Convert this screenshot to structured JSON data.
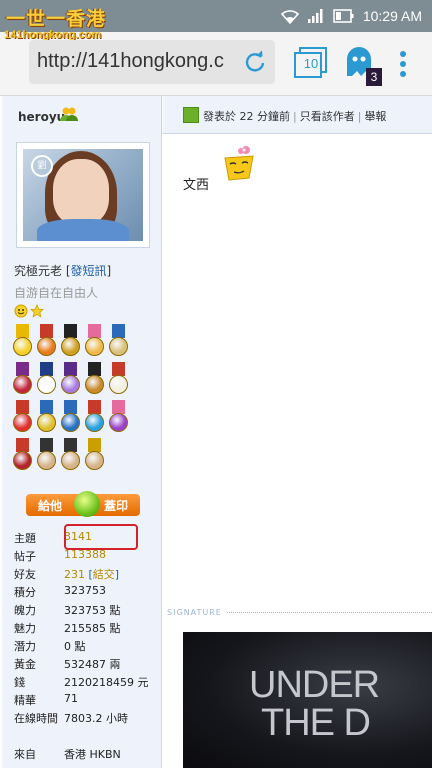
{
  "status_bar": {
    "logo": "一世一香港",
    "time": "10:29 AM"
  },
  "browser": {
    "site_logo": "141hongkong.com",
    "url": "http://141hongkong.c",
    "tab_count": "10",
    "ghost_badge": "3"
  },
  "user": {
    "name": "heroyu",
    "avatar_stamp": "劉",
    "rank_text": "究極元老 ",
    "rank_link_open": "[",
    "rank_link": "發短訊",
    "rank_link_close": "]",
    "motto": "自游自在自由人"
  },
  "medals": [
    {
      "ribbon": "#e8b900",
      "disc": "#f7d12a"
    },
    {
      "ribbon": "#c63a2a",
      "disc": "#e87b1a"
    },
    {
      "ribbon": "#222222",
      "disc": "#d0a020"
    },
    {
      "ribbon": "#e46b9a",
      "disc": "#f0b94a"
    },
    {
      "ribbon": "#2b6ab8",
      "disc": "#d9c07a"
    },
    {
      "ribbon": "#7a2b8a",
      "disc": "#c2263b"
    },
    {
      "ribbon": "#1f3e86",
      "disc": "#ffffff"
    },
    {
      "ribbon": "#5b2b8a",
      "disc": "#a77adf"
    },
    {
      "ribbon": "#222222",
      "disc": "#c98a2a"
    },
    {
      "ribbon": "#c63a2a",
      "disc": "#f2efe0"
    },
    {
      "ribbon": "#c63a2a",
      "disc": "#e03030"
    },
    {
      "ribbon": "#2b6ab8",
      "disc": "#e0c030"
    },
    {
      "ribbon": "#2b6ab8",
      "disc": "#2a72c6"
    },
    {
      "ribbon": "#c63a2a",
      "disc": "#2aa0e0"
    },
    {
      "ribbon": "#e46b9a",
      "disc": "#9a42c9"
    },
    {
      "ribbon": "#c63a2a",
      "disc": "#b3242a"
    },
    {
      "ribbon": "#333333",
      "disc": "#d6b48a"
    },
    {
      "ribbon": "#333333",
      "disc": "#d6b48a"
    },
    {
      "ribbon": "#c9a000",
      "disc": "#d6b48a"
    }
  ],
  "give_button": {
    "left": "給他",
    "right": "蓋印"
  },
  "stats": [
    {
      "label": "主題",
      "value": "3141",
      "style": "link"
    },
    {
      "label": "帖子",
      "value": "113388",
      "style": "link"
    },
    {
      "label": "好友",
      "value": "231",
      "extra": "結交",
      "style": "link"
    },
    {
      "label": "積分",
      "value": "323753",
      "style": "plain"
    },
    {
      "label": "魄力",
      "value": "323753 點",
      "style": "plain"
    },
    {
      "label": "魅力",
      "value": "215585 點",
      "style": "plain"
    },
    {
      "label": "潛力",
      "value": "0 點",
      "style": "plain"
    },
    {
      "label": "黃金",
      "value": "532487 兩",
      "style": "plain"
    },
    {
      "label": "錢",
      "value": "2120218459 元",
      "style": "plain"
    },
    {
      "label": "精華",
      "value": "71",
      "style": "plain"
    },
    {
      "label": "在線時間",
      "value": "7803.2 小時",
      "style": "plain"
    },
    {
      "label": "",
      "value": "",
      "style": "plain"
    },
    {
      "label": "來自",
      "value": "香港 HKBN",
      "style": "plain"
    }
  ],
  "post": {
    "posted": "發表於 22 分鐘前",
    "author_only": "只看該作者",
    "report": "舉報",
    "body": "文西"
  },
  "signature": {
    "label": "SIGNATURE",
    "line1": "UNDER",
    "line2": "THE D"
  }
}
